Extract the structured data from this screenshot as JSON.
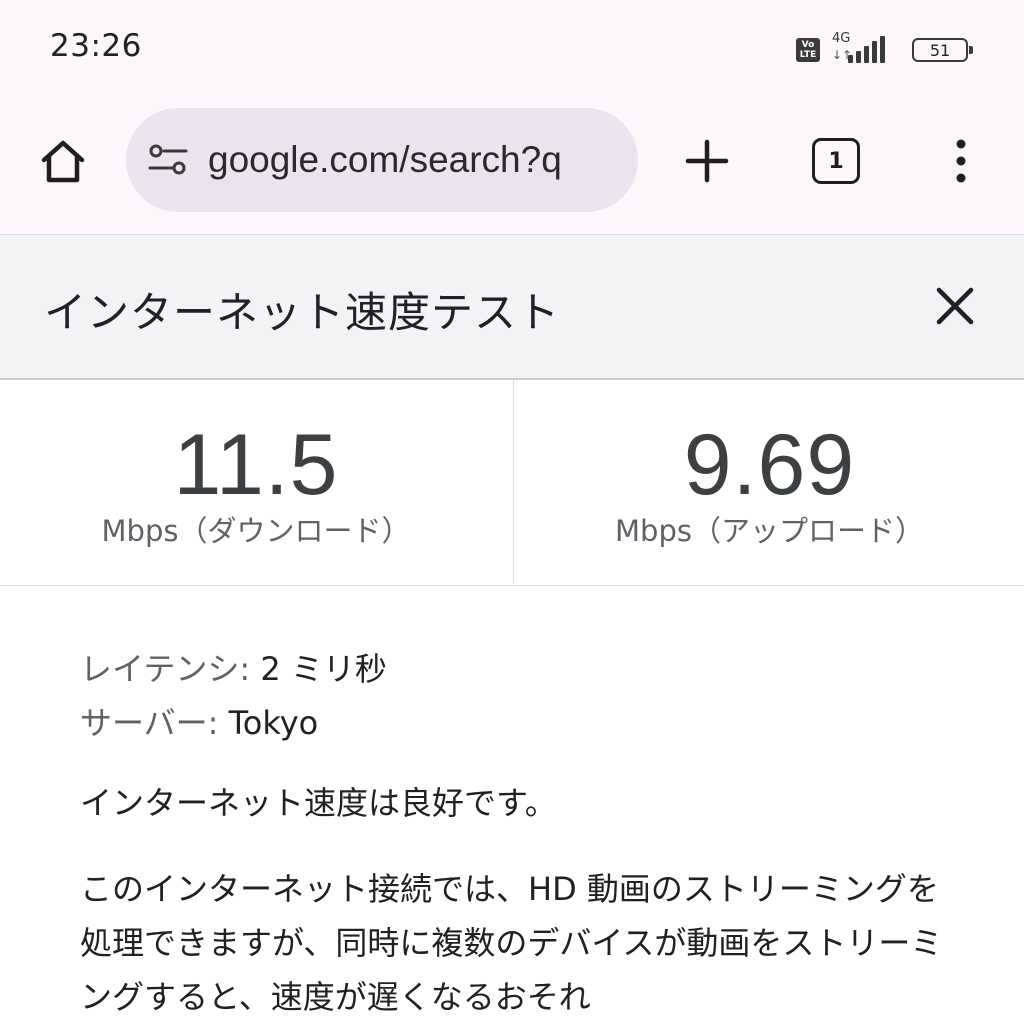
{
  "status_bar": {
    "time": "23:26",
    "volte_line1": "Vo",
    "volte_line2": "LTE",
    "network": "4G",
    "network_arrows": "↓↑",
    "battery": "51"
  },
  "browser": {
    "url": "google.com/search?q",
    "tab_count": "1"
  },
  "speed_test": {
    "title": "インターネット速度テスト",
    "download": {
      "value": "11.5",
      "label": "Mbps（ダウンロード）"
    },
    "upload": {
      "value": "9.69",
      "label": "Mbps（アップロード）"
    },
    "latency": {
      "key": "レイテンシ:",
      "value": " 2 ミリ秒"
    },
    "server": {
      "key": "サーバー:",
      "value": " Tokyo"
    },
    "summary": "インターネット速度は良好です。",
    "description": "このインターネット接続では、HD 動画のストリーミングを処理できますが、同時に複数のデバイスが動画をストリーミングすると、速度が遅くなるおそれ"
  },
  "icons": {
    "home": "home-icon",
    "tune": "tune-icon",
    "add": "plus-icon",
    "tabs": "tab-switcher-icon",
    "menu": "more-vert-icon",
    "close": "close-icon",
    "signal": "signal-icon",
    "battery": "battery-icon"
  }
}
